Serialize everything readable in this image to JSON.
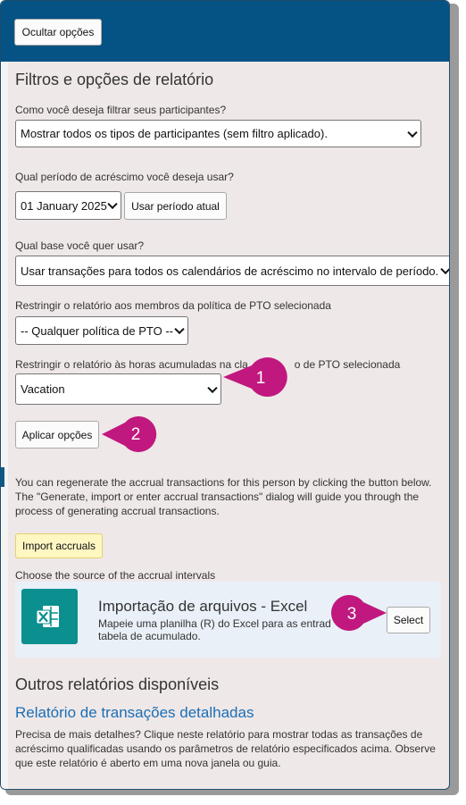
{
  "header": {
    "toggle_label": "Ocultar opções"
  },
  "filters": {
    "title": "Filtros e opções de relatório",
    "q1_label": "Como você deseja filtrar seus participantes?",
    "q1_value": "Mostrar todos os tipos de participantes (sem filtro aplicado).",
    "q2_label": "Qual período de acréscimo você deseja usar?",
    "q2_value": "01 January 2025",
    "use_current_label": "Usar período atual",
    "q3_label": "Qual base você quer usar?",
    "q3_value": "Usar transações para todos os calendários de acréscimo no intervalo de período.",
    "q4_label": "Restringir o relatório aos membros da política de PTO selecionada",
    "q4_value": "-- Qualquer política de PTO --",
    "q5_label_a": "Restringir o relatório às horas acumuladas na cla",
    "q5_label_b": "o de PTO selecionada",
    "q5_value": "Vacation",
    "apply_label": "Aplicar opções"
  },
  "regen": {
    "text_1": "You can regenerate the accrual transactions for this person by clicking the button below.",
    "text_2": "The \"Generate, import or enter accrual transactions\" dialog will guide you through the",
    "text_3": "process of generating accrual transactions.",
    "import_label": "Import accruals",
    "source_label": "Choose the source of the accrual intervals"
  },
  "source_card": {
    "icon": "excel-icon",
    "title": "Importação de arquivos - Excel",
    "desc_1": "Mapeie uma planilha (R) do Excel para as entrad",
    "desc_2": "tabela de acumulado.",
    "select_label": "Select"
  },
  "other_reports": {
    "heading": "Outros relatórios disponíveis",
    "link_label": "Relatório de transações detalhadas",
    "desc_1": "Precisa de mais detalhes? Clique neste relatório para mostrar todas as transações de",
    "desc_2": "acréscimo qualificadas usando os parâmetros de relatório especificados acima. Observe",
    "desc_3": "que este relatório é aberto em uma nova janela ou guia."
  },
  "callouts": [
    {
      "number": "1"
    },
    {
      "number": "2"
    },
    {
      "number": "3"
    }
  ],
  "colors": {
    "header": "#055285",
    "callout": "#c0187e",
    "link": "#1a6fb5",
    "import_button": "#fff7c2"
  }
}
